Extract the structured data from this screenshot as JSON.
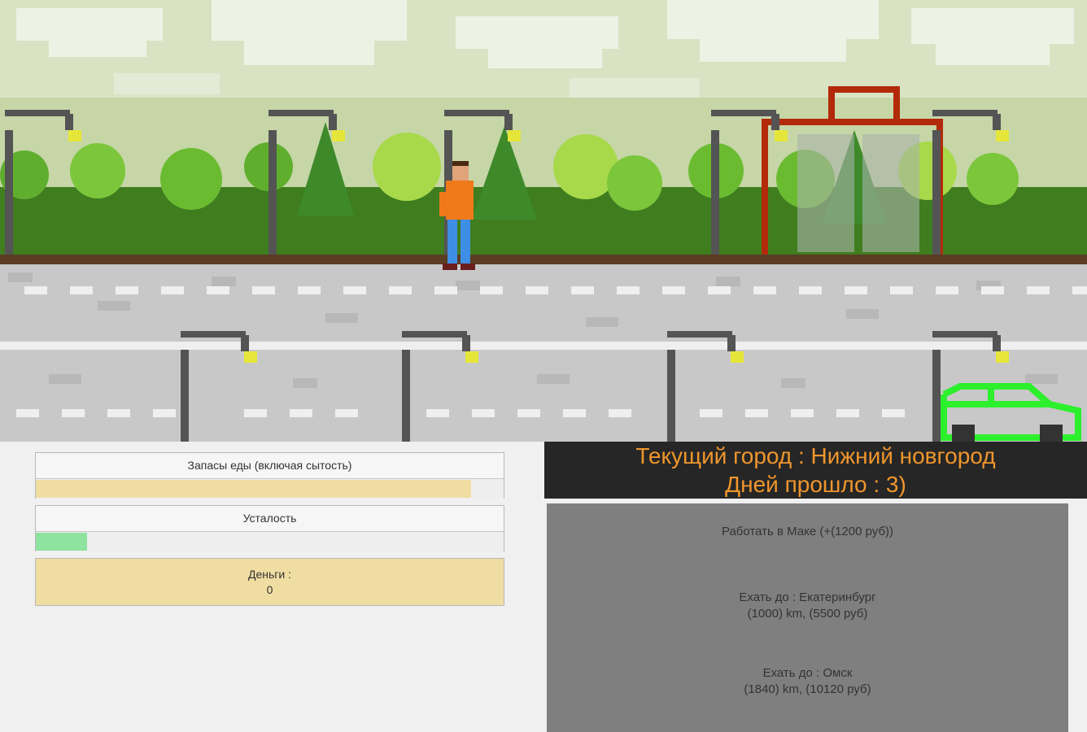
{
  "hud": {
    "food": {
      "label": "Запасы еды (включая сытость)",
      "level": 0.93,
      "color": "#efdda2"
    },
    "fatigue": {
      "label": "Усталость",
      "level": 0.11,
      "color": "#8ee39e"
    },
    "money": {
      "label": "Деньги :",
      "value": "0"
    }
  },
  "status": {
    "city": "Текущий город : Нижний новгород",
    "days": "Дней прошло : 3)"
  },
  "actions": {
    "work": {
      "line1": "Работать в Маке (+(1200 руб))"
    },
    "travel1": {
      "line1": "Ехать до : Екатеринбург",
      "line2": "(1000) km, (5500 руб)"
    },
    "travel2": {
      "line1": "Ехать до : Омск",
      "line2": "(1840) km, (10120 руб)"
    }
  },
  "colors": {
    "sky": "#dbe5c7",
    "cloud": "#eef2e4",
    "grass": "#3f7d1f",
    "road": "#c8c8c8",
    "car": "#2cf02c",
    "banner_text": "#f0962c"
  }
}
